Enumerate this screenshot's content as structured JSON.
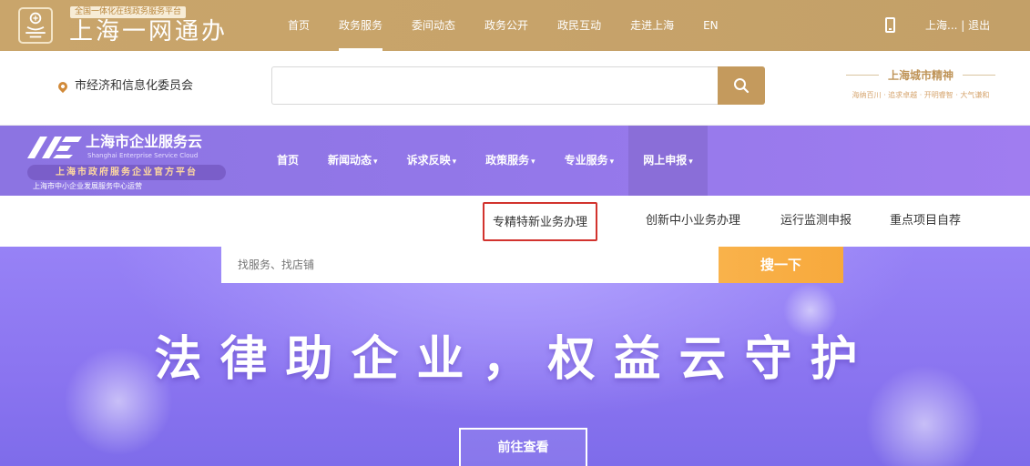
{
  "gov_header": {
    "tagline": "全国一体化在线政务服务平台",
    "brand": "上海一网通办",
    "nav": [
      "首页",
      "政务服务",
      "委间动态",
      "政务公开",
      "政民互动",
      "走进上海",
      "EN"
    ],
    "active_nav": "政务服务",
    "user_text": "上海... | 退出"
  },
  "search_row": {
    "location": "市经济和信息化委员会",
    "search_placeholder": "",
    "city_brand_title": "上海城市精神",
    "city_brand_sub": "海纳百川 · 追求卓越 · 开明睿智 · 大气谦和"
  },
  "enterprise_header": {
    "name": "上海市企业服务云",
    "name_en": "Shanghai Enterprise Service Cloud",
    "badge": "上海市政府服务企业官方平台",
    "operator": "上海市中小企业发展服务中心运营",
    "nav": [
      "首页",
      "新闻动态",
      "诉求反映",
      "政策服务",
      "专业服务",
      "网上申报"
    ],
    "dropdown_items": [
      "新闻动态",
      "诉求反映",
      "政策服务",
      "专业服务",
      "网上申报"
    ],
    "active_nav": "网上申报"
  },
  "submenu": {
    "items": [
      "专精特新业务办理",
      "创新中小业务办理",
      "运行监测申报",
      "重点项目自荐"
    ],
    "highlighted": "专精特新业务办理"
  },
  "hero": {
    "search_placeholder": "找服务、找店铺",
    "search_button": "搜一下",
    "title": "法律助企业，权益云守护",
    "cta": "前往查看"
  },
  "colors": {
    "gov_gold": "#c7a36a",
    "enterprise_purple": "#9478ea",
    "highlight_red": "#d2332e",
    "search_button_orange": "#f7a93c"
  }
}
